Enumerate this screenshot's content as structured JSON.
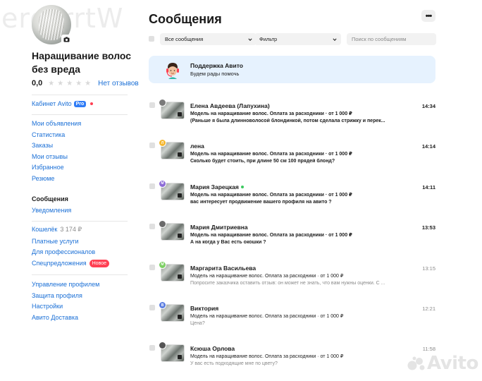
{
  "watermark_text": "erdzrrtW",
  "brand_watermark": "Avito",
  "sidebar": {
    "shop_name": "Наращивание волос без вреда",
    "rating": "0,0",
    "no_reviews": "Нет отзывов",
    "cabinet_label": "Кабинет Avito",
    "pro_badge": "Pro",
    "nav_group_1": [
      "Мои объявления",
      "Статистика",
      "Заказы",
      "Мои отзывы",
      "Избранное",
      "Резюме"
    ],
    "nav_group_2": [
      "Сообщения",
      "Уведомления"
    ],
    "wallet_label": "Кошелёк",
    "wallet_amount": "3 174 ₽",
    "nav_group_3": [
      "Платные услуги",
      "Для профессионалов",
      "Спецпредложения"
    ],
    "new_badge": "Новое",
    "nav_group_4": [
      "Управление профилем",
      "Защита профиля",
      "Настройки",
      "Авито Доставка"
    ]
  },
  "main": {
    "title": "Сообщения",
    "more_label": "•••",
    "filter_all": "Все сообщения",
    "filter": "Фильтр",
    "search_placeholder": "Поиск по сообщениям",
    "support": {
      "title": "Поддержка Авито",
      "subtitle": "Будем рады помочь"
    },
    "messages": [
      {
        "name": "Елена Авдеева (Лапухина)",
        "item": "Модель на наращивание волос. Оплата за расходники · от 1 000 ₽",
        "text": "(Раньше я была длинноволосой блондинкой, потом сделала стрижку и перек...",
        "time": "14:34",
        "unread": true,
        "online": false,
        "avatar_letter": "",
        "avatar_color": "#7a7a7a"
      },
      {
        "name": "лена",
        "item": "Модель на наращивание волос. Оплата за расходники · от 1 000 ₽",
        "text": "Сколько будет стоить, при длине 50 см 100 прядей блонд?",
        "time": "14:14",
        "unread": true,
        "online": false,
        "avatar_letter": "Л",
        "avatar_color": "#f5b731"
      },
      {
        "name": "Мария Зарецкая",
        "item": "Модель на наращивание волос. Оплата за расходники · от 1 000 ₽",
        "text": "вас интересует продвижение вашего профиля на авито ?",
        "time": "14:11",
        "unread": true,
        "online": true,
        "avatar_letter": "М",
        "avatar_color": "#8c6bd6"
      },
      {
        "name": "Мария Дмитриевна",
        "item": "Модель на наращивание волос. Оплата за расходники · от 1 000 ₽",
        "text": "А на когда у Вас есть окошки ?",
        "time": "13:53",
        "unread": true,
        "online": false,
        "avatar_letter": "",
        "avatar_color": "#6a6a6a"
      },
      {
        "name": "Маргарита Васильева",
        "item": "Модель на наращивание волос. Оплата за расходники · от 1 000 ₽",
        "text": "Попросите заказчика оставить отзыв: он может не знать, что вам нужны оценки. С ...",
        "time": "13:15",
        "unread": false,
        "online": false,
        "avatar_letter": "М",
        "avatar_color": "#7ccf63"
      },
      {
        "name": "Виктория",
        "item": "Модель на наращивание волос. Оплата за расходники · от 1 000 ₽",
        "text": "Цена?",
        "time": "12:21",
        "unread": false,
        "online": false,
        "avatar_letter": "В",
        "avatar_color": "#5d7fe0"
      },
      {
        "name": "Ксюша Орлова",
        "item": "Модель на наращивание волос. Оплата за расходники · от 1 000 ₽",
        "text": "У вас есть подходящие мне по цвету?",
        "time": "11:58",
        "unread": false,
        "online": false,
        "avatar_letter": "",
        "avatar_color": "#555555"
      }
    ]
  },
  "colors": {
    "link": "#1a6fd6",
    "badge_red": "#ff4053",
    "pro_blue": "#2f7cf6",
    "support_bg": "#e6f2fe",
    "online": "#3bc95f"
  }
}
